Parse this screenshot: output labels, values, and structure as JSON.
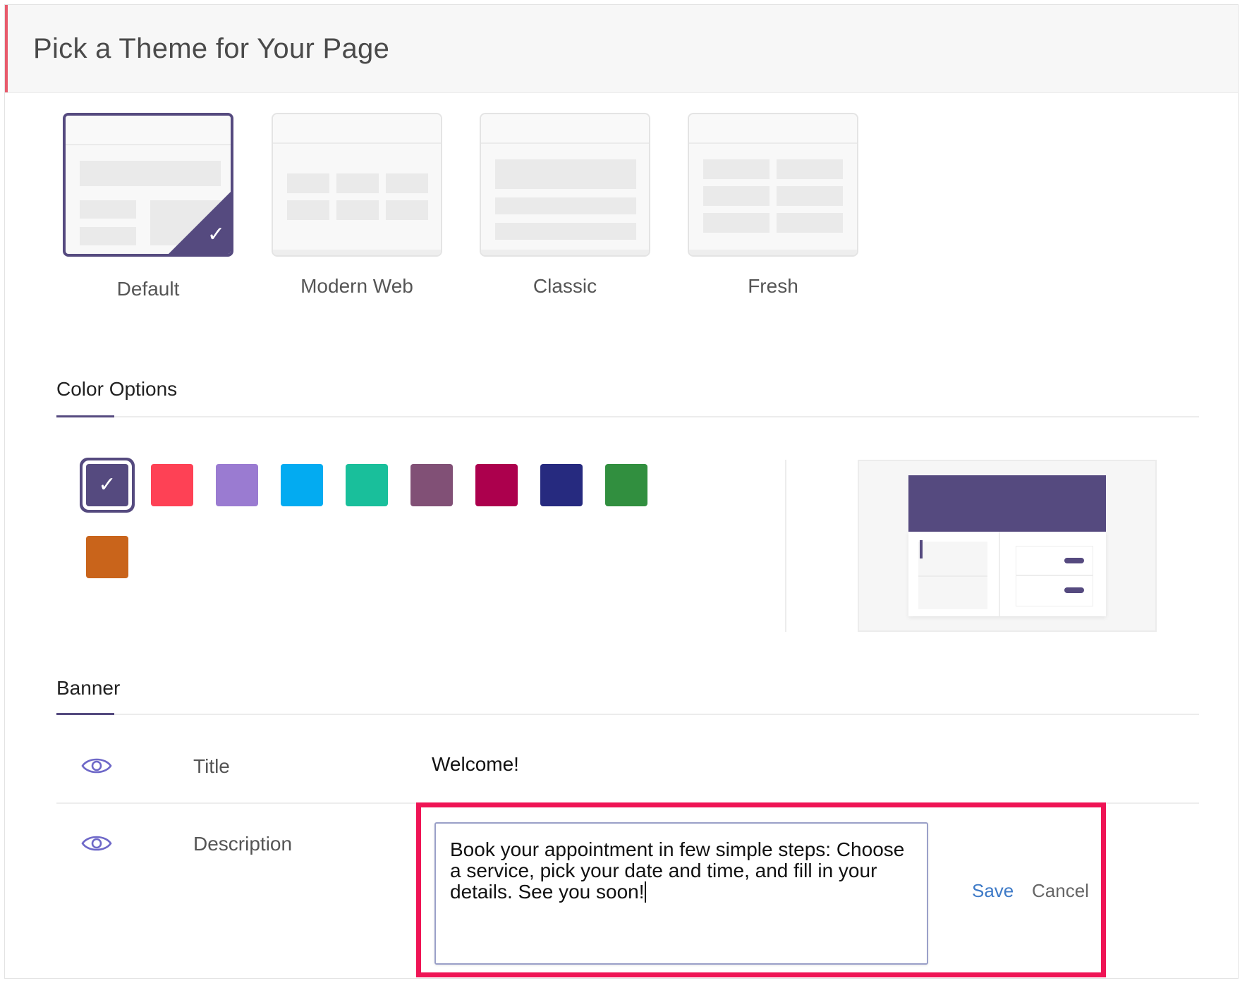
{
  "header": {
    "title": "Pick a Theme for Your Page"
  },
  "themes": [
    {
      "label": "Default",
      "selected": true
    },
    {
      "label": "Modern Web",
      "selected": false
    },
    {
      "label": "Classic",
      "selected": false
    },
    {
      "label": "Fresh",
      "selected": false
    }
  ],
  "color_options": {
    "heading": "Color Options",
    "selected_index": 0,
    "swatches": [
      "#554a7f",
      "#fe4155",
      "#9a7bd1",
      "#03abf1",
      "#19bf9b",
      "#815076",
      "#ac004d",
      "#262a7f",
      "#318f3f",
      "#c9641b"
    ],
    "check_glyph": "✓"
  },
  "banner": {
    "heading": "Banner",
    "title_row": {
      "label": "Title",
      "value": "Welcome!",
      "icon": "eye-icon"
    },
    "description_row": {
      "label": "Description",
      "icon": "eye-icon",
      "value": " Book your appointment in few simple steps: Choose a service, pick your date and time, and fill in your details. See you soon!"
    },
    "save_label": "Save",
    "cancel_label": "Cancel"
  },
  "colors": {
    "accent": "#554a7f",
    "highlight": "#ef1455",
    "link": "#3e7ac7"
  }
}
